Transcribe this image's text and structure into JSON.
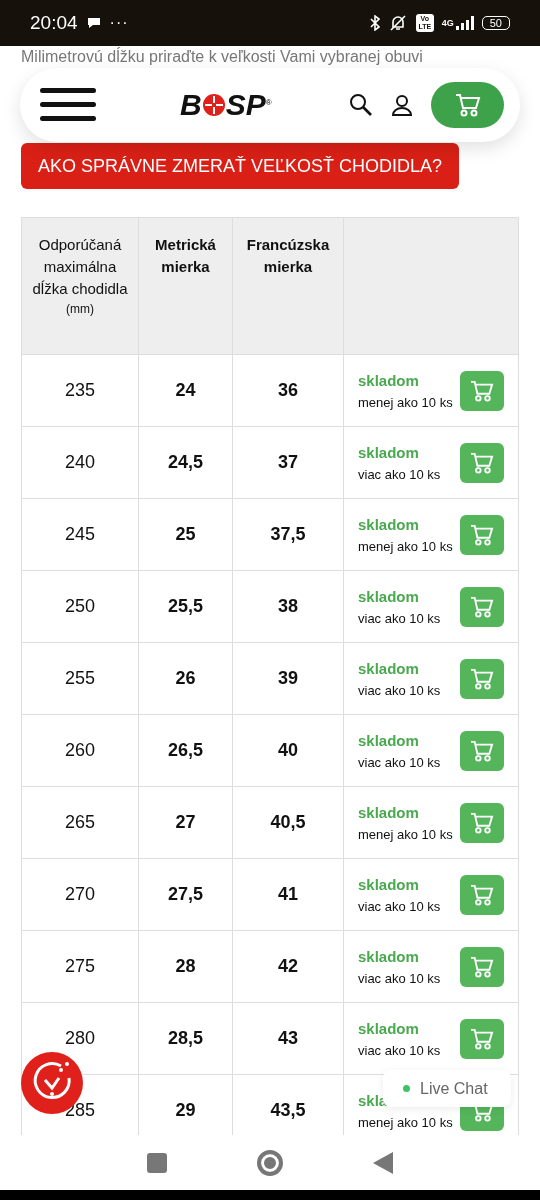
{
  "status_bar": {
    "time": "20:04",
    "more": "···",
    "volte": "Vo LTE",
    "network": "4G",
    "battery": "50"
  },
  "intro": "Milimetrovú dĺžku priraďte k veľkosti Vami vybranej obuvi",
  "header": {
    "logo": "B",
    "logo_rest": "SP",
    "registered": "®"
  },
  "measure_button": "AKO SPRÁVNE ZMERAŤ VEĽKOSŤ CHODIDLA?",
  "table": {
    "columns": [
      {
        "label": "Odporúčaná maximálna dĺžka chodidla",
        "unit": "(mm)"
      },
      {
        "label": "Metrická mierka"
      },
      {
        "label": "Francúzska mierka"
      }
    ],
    "rows": [
      {
        "length": "235",
        "metric": "24",
        "french": "36",
        "stock": "skladom",
        "amount": "menej ako 10 ks"
      },
      {
        "length": "240",
        "metric": "24,5",
        "french": "37",
        "stock": "skladom",
        "amount": "viac ako 10 ks"
      },
      {
        "length": "245",
        "metric": "25",
        "french": "37,5",
        "stock": "skladom",
        "amount": "menej ako 10 ks"
      },
      {
        "length": "250",
        "metric": "25,5",
        "french": "38",
        "stock": "skladom",
        "amount": "viac ako 10 ks"
      },
      {
        "length": "255",
        "metric": "26",
        "french": "39",
        "stock": "skladom",
        "amount": "viac ako 10 ks"
      },
      {
        "length": "260",
        "metric": "26,5",
        "french": "40",
        "stock": "skladom",
        "amount": "viac ako 10 ks"
      },
      {
        "length": "265",
        "metric": "27",
        "french": "40,5",
        "stock": "skladom",
        "amount": "menej ako 10 ks"
      },
      {
        "length": "270",
        "metric": "27,5",
        "french": "41",
        "stock": "skladom",
        "amount": "viac ako 10 ks"
      },
      {
        "length": "275",
        "metric": "28",
        "french": "42",
        "stock": "skladom",
        "amount": "viac ako 10 ks"
      },
      {
        "length": "280",
        "metric": "28,5",
        "french": "43",
        "stock": "skladom",
        "amount": "viac ako 10 ks"
      },
      {
        "length": "285",
        "metric": "29",
        "french": "43,5",
        "stock": "skla",
        "amount": "menej ako 10 ks"
      }
    ]
  },
  "live_chat": {
    "label": "Live Chat",
    "online": true
  }
}
